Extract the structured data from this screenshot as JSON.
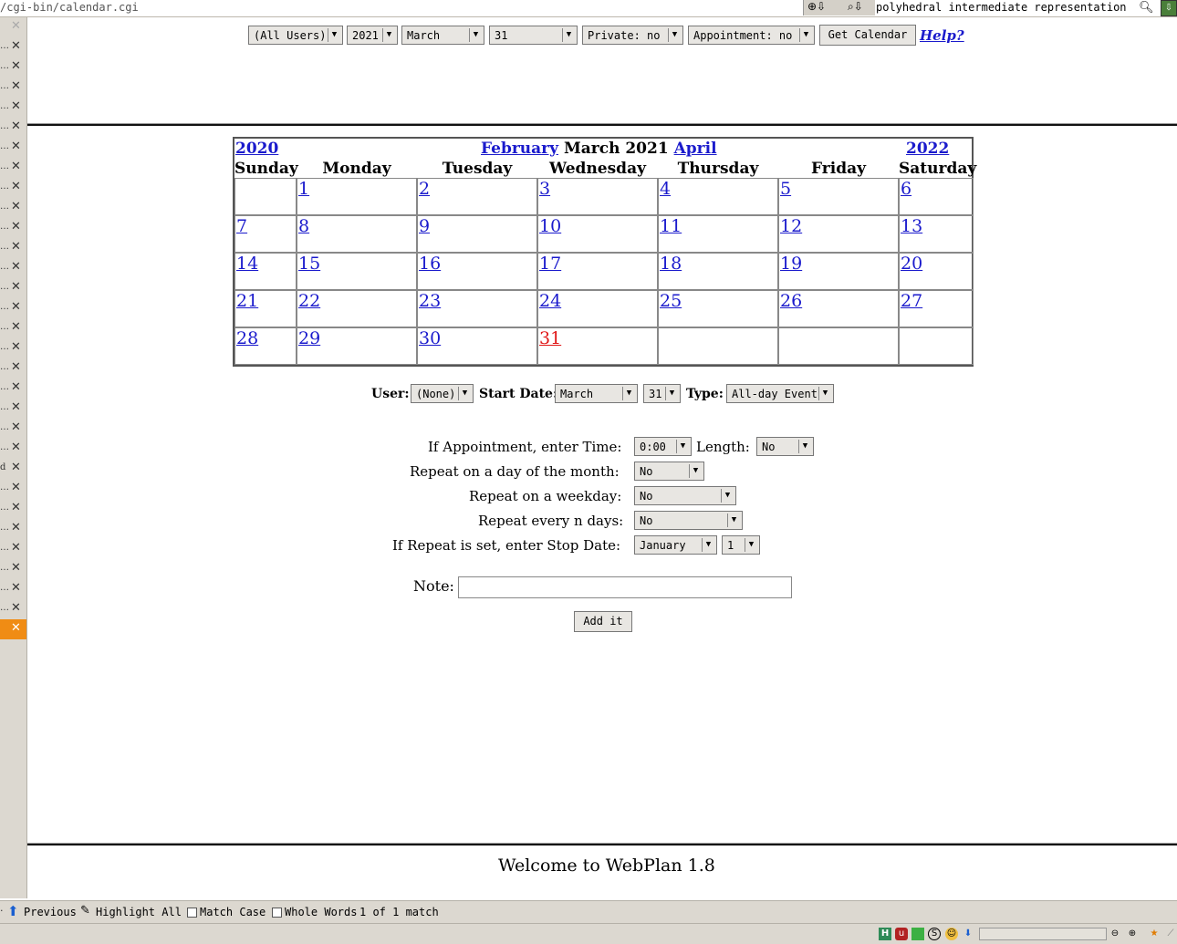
{
  "browser": {
    "url": "/cgi-bin/calendar.cgi",
    "search_text": "polyhedral intermediate representation"
  },
  "topform": {
    "user": "(All Users)",
    "year": "2021",
    "month": "March",
    "day": "31",
    "private": "Private: no",
    "appointment": "Appointment: no",
    "get_calendar": "Get Calendar",
    "help": "Help?"
  },
  "calendar": {
    "prev_year": "2020",
    "prev_month": "February",
    "current": "March 2021",
    "next_month": "April",
    "next_year": "2022",
    "weekdays": [
      "Sunday",
      "Monday",
      "Tuesday",
      "Wednesday",
      "Thursday",
      "Friday",
      "Saturday"
    ],
    "days": [
      "1",
      "2",
      "3",
      "4",
      "5",
      "6",
      "7",
      "8",
      "9",
      "10",
      "11",
      "12",
      "13",
      "14",
      "15",
      "16",
      "17",
      "18",
      "19",
      "20",
      "21",
      "22",
      "23",
      "24",
      "25",
      "26",
      "27",
      "28",
      "29",
      "30",
      "31"
    ],
    "today": "31"
  },
  "eventform": {
    "user_label": "User:",
    "user_value": "(None)",
    "start_label": "Start Date:",
    "start_month": "March",
    "start_day": "31",
    "type_label": "Type:",
    "type_value": "All-day Event",
    "appt_label": "If Appointment, enter Time:",
    "time_value": "0:00",
    "length_label": "Length:",
    "length_value": "No",
    "repeat_month_label": "Repeat on a day of the month:",
    "repeat_month_value": "No",
    "repeat_weekday_label": "Repeat on a weekday:",
    "repeat_weekday_value": "No",
    "repeat_n_label": "Repeat every n days:",
    "repeat_n_value": "No",
    "stop_label": "If Repeat is set, enter Stop Date:",
    "stop_month": "January",
    "stop_day": "1",
    "note_label": "Note:",
    "note_value": "",
    "add_button": "Add it"
  },
  "footer": {
    "welcome": "Welcome to WebPlan 1.8"
  },
  "findbar": {
    "previous": "Previous",
    "highlight_all": "Highlight All",
    "match_case": "Match Case",
    "whole_words": "Whole Words",
    "status": "1 of 1 match"
  },
  "tabs": {
    "partial_label": "d"
  }
}
